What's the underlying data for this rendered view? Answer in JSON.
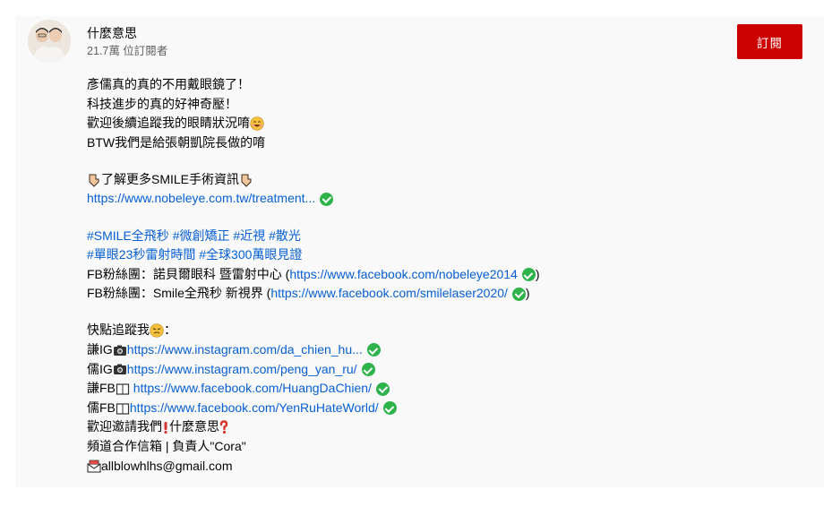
{
  "channel": {
    "name": "什麼意思",
    "subscribers": "21.7萬 位訂閱者",
    "subscribe_label": "訂閱"
  },
  "description": {
    "intro": [
      "彥儒真的真的不用戴眼鏡了！",
      "科技進步的真的好神奇壓！",
      "歡迎後續追蹤我的眼睛狀況唷",
      "BTW我們是給張朝凱院長做的唷"
    ],
    "more_info": "了解更多SMILE手術資訊",
    "treatment_link": "https://www.nobeleye.com.tw/treatment...",
    "hashtags_line1": [
      "#SMILE全飛秒",
      "#微創矯正",
      "#近視",
      "#散光"
    ],
    "hashtags_line2": [
      "#單眼23秒雷射時間",
      "#全球300萬眼見證"
    ],
    "fb1_prefix": "FB粉絲團：諾貝爾眼科 暨雷射中心 (",
    "fb1_link": "https://www.facebook.com/nobeleye2014",
    "fb1_suffix": ")",
    "fb2_prefix": "FB粉絲團：Smile全飛秒 新視界 (",
    "fb2_link": "https://www.facebook.com/smilelaser2020/",
    "fb2_suffix": ")",
    "follow_label": "快點追蹤我",
    "follow_colon": "：",
    "social": [
      {
        "prefix": "謙IG",
        "link": "https://www.instagram.com/da_chien_hu...",
        "icon": "camera-icon"
      },
      {
        "prefix": "儒IG",
        "link": "https://www.instagram.com/peng_yan_ru/",
        "icon": "camera-icon"
      },
      {
        "prefix": "謙FB",
        "link": "https://www.facebook.com/HuangDaChien/",
        "icon": "book-icon"
      },
      {
        "prefix": "儒FB",
        "link": "https://www.facebook.com/YenRuHateWorld/",
        "icon": "book-icon"
      }
    ],
    "invite_prefix": "歡迎邀請我們",
    "invite_name": "什麼意思",
    "business": "頻道合作信箱 | 負責人\"Cora\"",
    "email": "allblowhlhs@gmail.com"
  },
  "colors": {
    "link": "#065fd4",
    "subscribe": "#cc0000",
    "check": "#2db34a"
  }
}
